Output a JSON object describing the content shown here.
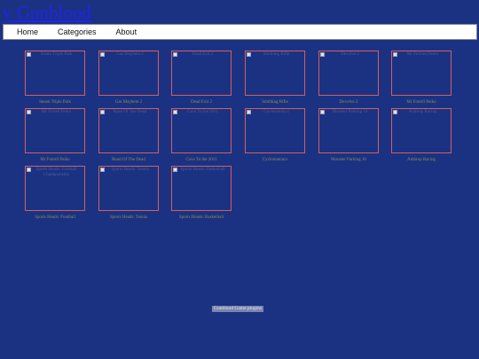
{
  "header": {
    "title": "y Gunblood"
  },
  "nav": {
    "items": [
      {
        "label": "Home"
      },
      {
        "label": "Categories"
      },
      {
        "label": "About"
      }
    ]
  },
  "games": [
    {
      "alt": "Steam Triple Park",
      "caption": "Steam Triple Park"
    },
    {
      "alt": "Gas Mayhem 2",
      "caption": "Gas Mayhem 2"
    },
    {
      "alt": "Dead Exit 2",
      "caption": "Dead Exit 2"
    },
    {
      "alt": "Smithing Rifle",
      "caption": "Smithing Rifle"
    },
    {
      "alt": "Devolve 2",
      "caption": "Devolve 2"
    },
    {
      "alt": "Mr Formed Peiko",
      "caption": "Mr Fotrell Peiko"
    },
    {
      "alt": "Mr Fotrell Peiko",
      "caption": "Mr Fotrell Peiko"
    },
    {
      "alt": "Road Of The Dead",
      "caption": "Road Of The Dead"
    },
    {
      "alt": "Cave To the 2011",
      "caption": "Cave To the 2011"
    },
    {
      "alt": "Cyclomaniacs",
      "caption": "Cyclomaniacs"
    },
    {
      "alt": "Monster Parking 10",
      "caption": "Monster Parking 10"
    },
    {
      "alt": "Ambrop Racing",
      "caption": "Ambrop Racing"
    },
    {
      "alt": "Sports Heads: Football Championship",
      "caption": "Sports Heads: Football"
    },
    {
      "alt": "Sports Heads: Tennis",
      "caption": "Sports Heads: Tennis"
    },
    {
      "alt": "Sports Heads: Basketball",
      "caption": "Sports Heads: Basketball"
    }
  ],
  "footer": {
    "link_label": "Gunblood Game plugins"
  }
}
